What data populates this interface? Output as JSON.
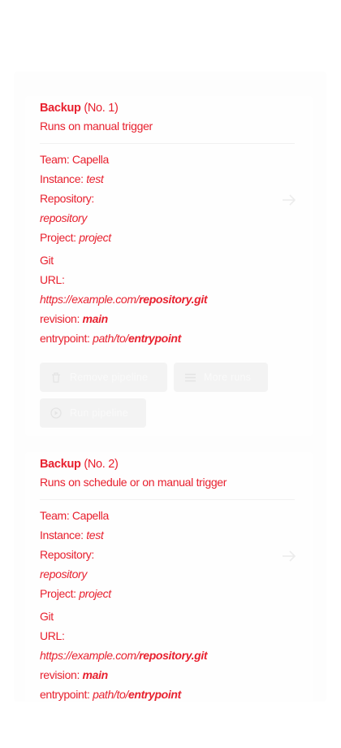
{
  "colors": {
    "accent": "#e8212f",
    "card_bg": "#fefefe",
    "button_bg": "#f3f3f3"
  },
  "pipelines": [
    {
      "name": "Backup",
      "number": "(No. 1)",
      "trigger": "Runs on manual trigger",
      "team_label": "Team: ",
      "team": "Capella",
      "instance_label": "Instance: ",
      "instance": "test",
      "repository_label": "Repository:",
      "repository": "repository",
      "project_label": "Project: ",
      "project": "project",
      "git_label": "Git",
      "url_label": "URL:",
      "url_prefix": "https://example.com/",
      "url_bold": "repository.git",
      "revision_label": "revision: ",
      "revision": "main",
      "entrypoint_label": "entrypoint: ",
      "entrypoint_prefix": "path/to/",
      "entrypoint_bold": "entrypoint",
      "buttons": {
        "remove": "Remove pipeline",
        "runs": "More runs",
        "run": "Run pipeline"
      }
    },
    {
      "name": "Backup",
      "number": "(No. 2)",
      "trigger": "Runs on schedule or on manual trigger",
      "team_label": "Team: ",
      "team": "Capella",
      "instance_label": "Instance: ",
      "instance": "test",
      "repository_label": "Repository:",
      "repository": "repository",
      "project_label": "Project: ",
      "project": "project",
      "git_label": "Git",
      "url_label": "URL:",
      "url_prefix": "https://example.com/",
      "url_bold": "repository.git",
      "revision_label": "revision: ",
      "revision": "main",
      "entrypoint_label": "entrypoint: ",
      "entrypoint_prefix": "path/to/",
      "entrypoint_bold": "entrypoint"
    }
  ]
}
